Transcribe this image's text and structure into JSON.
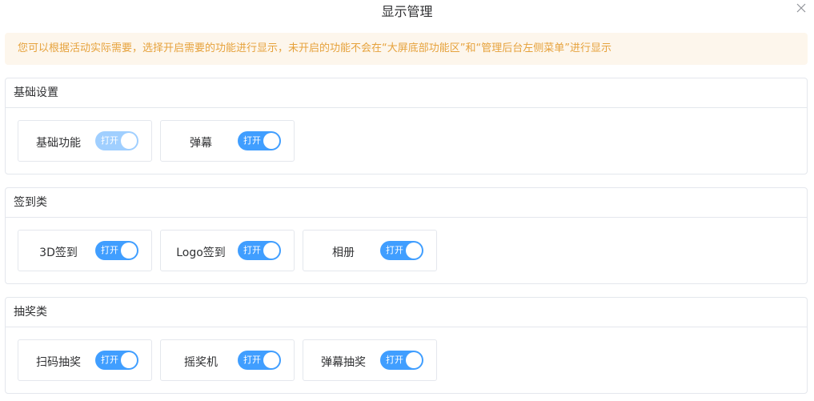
{
  "dialog": {
    "title": "显示管理",
    "notice": "您可以根据活动实际需要，选择开启需要的功能进行显示，未开启的功能不会在“大屏底部功能区”和“管理后台左侧菜单”进行显示"
  },
  "icons": {
    "close": "close-icon"
  },
  "colors": {
    "accent": "#409eff",
    "accent_disabled": "#a0cfff",
    "warning_text": "#e6a23c",
    "warning_bg": "#fdf6ec",
    "border": "#e4e7ed"
  },
  "sections": [
    {
      "title": "基础设置",
      "items": [
        {
          "label": "基础功能",
          "switch_text": "打开",
          "on": true,
          "disabled": true
        },
        {
          "label": "弹幕",
          "switch_text": "打开",
          "on": true,
          "disabled": false
        }
      ]
    },
    {
      "title": "签到类",
      "items": [
        {
          "label": "3D签到",
          "switch_text": "打开",
          "on": true,
          "disabled": false
        },
        {
          "label": "Logo签到",
          "switch_text": "打开",
          "on": true,
          "disabled": false
        },
        {
          "label": "相册",
          "switch_text": "打开",
          "on": true,
          "disabled": false
        }
      ]
    },
    {
      "title": "抽奖类",
      "items": [
        {
          "label": "扫码抽奖",
          "switch_text": "打开",
          "on": true,
          "disabled": false
        },
        {
          "label": "摇奖机",
          "switch_text": "打开",
          "on": true,
          "disabled": false
        },
        {
          "label": "弹幕抽奖",
          "switch_text": "打开",
          "on": true,
          "disabled": false
        }
      ]
    }
  ]
}
